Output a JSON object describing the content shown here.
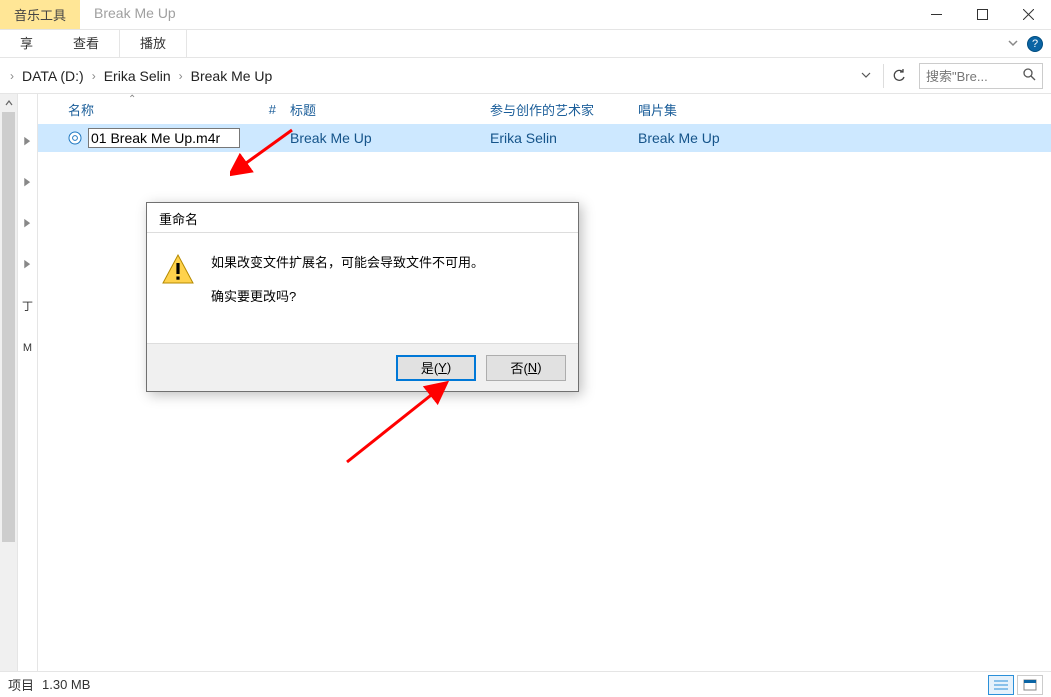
{
  "titlebar": {
    "tool_tab": "音乐工具",
    "window_title": "Break Me Up"
  },
  "ribbon": {
    "tabs": [
      "享",
      "查看",
      "播放"
    ]
  },
  "breadcrumbs": {
    "items": [
      "DATA (D:)",
      "Erika Selin",
      "Break Me Up"
    ]
  },
  "search": {
    "placeholder": "搜索\"Bre..."
  },
  "columns": {
    "name": "名称",
    "number": "#",
    "title": "标题",
    "artist": "参与创作的艺术家",
    "album": "唱片集"
  },
  "nav_strip": {
    "marker1": "丁",
    "marker2": "M"
  },
  "file_row": {
    "filename": "01 Break Me Up.m4r",
    "title": "Break Me Up",
    "artist": "Erika Selin",
    "album": "Break Me Up"
  },
  "dialog": {
    "title": "重命名",
    "line1": "如果改变文件扩展名，可能会导致文件不可用。",
    "line2": "确实要更改吗?",
    "yes": "是(",
    "yes_key": "Y",
    "yes_close": ")",
    "no": "否(",
    "no_key": "N",
    "no_close": ")"
  },
  "statusbar": {
    "items_label": "项目",
    "size": "1.30 MB"
  }
}
